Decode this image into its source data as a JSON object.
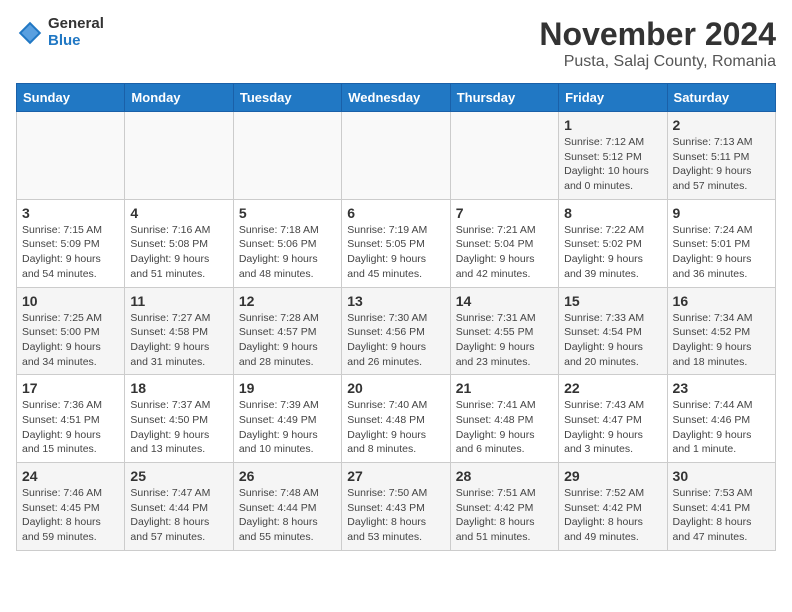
{
  "logo": {
    "general": "General",
    "blue": "Blue"
  },
  "title": "November 2024",
  "subtitle": "Pusta, Salaj County, Romania",
  "days_of_week": [
    "Sunday",
    "Monday",
    "Tuesday",
    "Wednesday",
    "Thursday",
    "Friday",
    "Saturday"
  ],
  "weeks": [
    [
      {
        "day": "",
        "info": ""
      },
      {
        "day": "",
        "info": ""
      },
      {
        "day": "",
        "info": ""
      },
      {
        "day": "",
        "info": ""
      },
      {
        "day": "",
        "info": ""
      },
      {
        "day": "1",
        "info": "Sunrise: 7:12 AM\nSunset: 5:12 PM\nDaylight: 10 hours and 0 minutes."
      },
      {
        "day": "2",
        "info": "Sunrise: 7:13 AM\nSunset: 5:11 PM\nDaylight: 9 hours and 57 minutes."
      }
    ],
    [
      {
        "day": "3",
        "info": "Sunrise: 7:15 AM\nSunset: 5:09 PM\nDaylight: 9 hours and 54 minutes."
      },
      {
        "day": "4",
        "info": "Sunrise: 7:16 AM\nSunset: 5:08 PM\nDaylight: 9 hours and 51 minutes."
      },
      {
        "day": "5",
        "info": "Sunrise: 7:18 AM\nSunset: 5:06 PM\nDaylight: 9 hours and 48 minutes."
      },
      {
        "day": "6",
        "info": "Sunrise: 7:19 AM\nSunset: 5:05 PM\nDaylight: 9 hours and 45 minutes."
      },
      {
        "day": "7",
        "info": "Sunrise: 7:21 AM\nSunset: 5:04 PM\nDaylight: 9 hours and 42 minutes."
      },
      {
        "day": "8",
        "info": "Sunrise: 7:22 AM\nSunset: 5:02 PM\nDaylight: 9 hours and 39 minutes."
      },
      {
        "day": "9",
        "info": "Sunrise: 7:24 AM\nSunset: 5:01 PM\nDaylight: 9 hours and 36 minutes."
      }
    ],
    [
      {
        "day": "10",
        "info": "Sunrise: 7:25 AM\nSunset: 5:00 PM\nDaylight: 9 hours and 34 minutes."
      },
      {
        "day": "11",
        "info": "Sunrise: 7:27 AM\nSunset: 4:58 PM\nDaylight: 9 hours and 31 minutes."
      },
      {
        "day": "12",
        "info": "Sunrise: 7:28 AM\nSunset: 4:57 PM\nDaylight: 9 hours and 28 minutes."
      },
      {
        "day": "13",
        "info": "Sunrise: 7:30 AM\nSunset: 4:56 PM\nDaylight: 9 hours and 26 minutes."
      },
      {
        "day": "14",
        "info": "Sunrise: 7:31 AM\nSunset: 4:55 PM\nDaylight: 9 hours and 23 minutes."
      },
      {
        "day": "15",
        "info": "Sunrise: 7:33 AM\nSunset: 4:54 PM\nDaylight: 9 hours and 20 minutes."
      },
      {
        "day": "16",
        "info": "Sunrise: 7:34 AM\nSunset: 4:52 PM\nDaylight: 9 hours and 18 minutes."
      }
    ],
    [
      {
        "day": "17",
        "info": "Sunrise: 7:36 AM\nSunset: 4:51 PM\nDaylight: 9 hours and 15 minutes."
      },
      {
        "day": "18",
        "info": "Sunrise: 7:37 AM\nSunset: 4:50 PM\nDaylight: 9 hours and 13 minutes."
      },
      {
        "day": "19",
        "info": "Sunrise: 7:39 AM\nSunset: 4:49 PM\nDaylight: 9 hours and 10 minutes."
      },
      {
        "day": "20",
        "info": "Sunrise: 7:40 AM\nSunset: 4:48 PM\nDaylight: 9 hours and 8 minutes."
      },
      {
        "day": "21",
        "info": "Sunrise: 7:41 AM\nSunset: 4:48 PM\nDaylight: 9 hours and 6 minutes."
      },
      {
        "day": "22",
        "info": "Sunrise: 7:43 AM\nSunset: 4:47 PM\nDaylight: 9 hours and 3 minutes."
      },
      {
        "day": "23",
        "info": "Sunrise: 7:44 AM\nSunset: 4:46 PM\nDaylight: 9 hours and 1 minute."
      }
    ],
    [
      {
        "day": "24",
        "info": "Sunrise: 7:46 AM\nSunset: 4:45 PM\nDaylight: 8 hours and 59 minutes."
      },
      {
        "day": "25",
        "info": "Sunrise: 7:47 AM\nSunset: 4:44 PM\nDaylight: 8 hours and 57 minutes."
      },
      {
        "day": "26",
        "info": "Sunrise: 7:48 AM\nSunset: 4:44 PM\nDaylight: 8 hours and 55 minutes."
      },
      {
        "day": "27",
        "info": "Sunrise: 7:50 AM\nSunset: 4:43 PM\nDaylight: 8 hours and 53 minutes."
      },
      {
        "day": "28",
        "info": "Sunrise: 7:51 AM\nSunset: 4:42 PM\nDaylight: 8 hours and 51 minutes."
      },
      {
        "day": "29",
        "info": "Sunrise: 7:52 AM\nSunset: 4:42 PM\nDaylight: 8 hours and 49 minutes."
      },
      {
        "day": "30",
        "info": "Sunrise: 7:53 AM\nSunset: 4:41 PM\nDaylight: 8 hours and 47 minutes."
      }
    ]
  ]
}
